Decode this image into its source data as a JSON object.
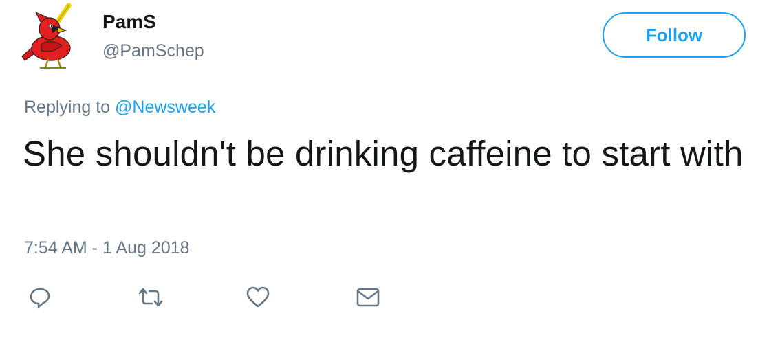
{
  "user": {
    "name": "PamS",
    "handle": "@PamSchep",
    "avatar_icon": "cardinal-logo-icon"
  },
  "follow_label": "Follow",
  "reply": {
    "prefix": "Replying to",
    "mention": "@Newsweek"
  },
  "tweet_text": "She shouldn't be drinking caffeine to start with",
  "timestamp": "7:54 AM - 1 Aug 2018",
  "actions": [
    {
      "icon": "reply-icon"
    },
    {
      "icon": "retweet-icon"
    },
    {
      "icon": "like-icon"
    },
    {
      "icon": "message-icon"
    }
  ],
  "colors": {
    "accent": "#1da1f2",
    "text": "#14171a",
    "secondary": "#657786"
  }
}
